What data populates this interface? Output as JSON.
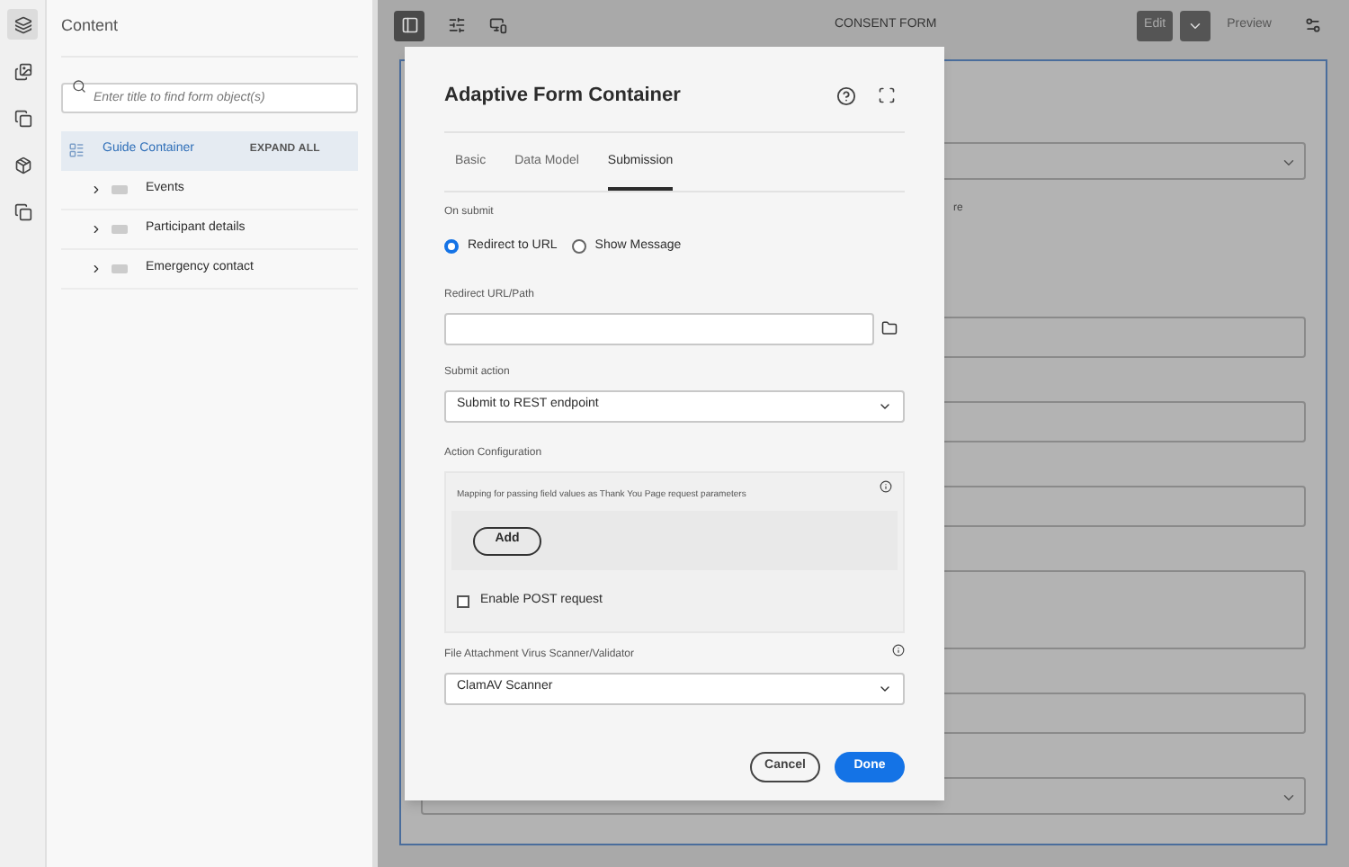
{
  "rail_items": [
    {
      "selected": true
    },
    {
      "selected": false
    },
    {
      "selected": false
    },
    {
      "selected": false
    },
    {
      "selected": false
    }
  ],
  "sidebar": {
    "title": "Content",
    "search": {
      "placeholder": "Enter title to find form object(s)"
    },
    "root": {
      "label": "Guide Container",
      "selected": true
    },
    "expand_all": "EXPAND ALL",
    "items": [
      {
        "label": "Events",
        "expanded": false
      },
      {
        "label": "Participant details",
        "expanded": false
      },
      {
        "label": "Emergency contact",
        "expanded": false
      }
    ]
  },
  "toolbar": {
    "title": "CONSENT FORM",
    "edit": "Edit",
    "preview": "Preview"
  },
  "background_form": {
    "fragment_text": "re"
  },
  "dialog": {
    "title": "Adaptive Form Container",
    "tabs": [
      {
        "label": "Basic",
        "selected": false
      },
      {
        "label": "Data Model",
        "selected": false
      },
      {
        "label": "Submission",
        "selected": true
      }
    ],
    "on_submit": {
      "label": "On submit",
      "options": [
        {
          "label": "Redirect to URL",
          "selected": true
        },
        {
          "label": "Show Message",
          "selected": false
        }
      ]
    },
    "redirect": {
      "label": "Redirect URL/Path"
    },
    "submit_action": {
      "label": "Submit action",
      "value": "Submit to REST endpoint"
    },
    "action_configuration": {
      "label": "Action Configuration",
      "description": "Mapping for passing field values as Thank You Page request parameters",
      "add_button": "Add",
      "enable_post": {
        "label": "Enable POST request",
        "checked": false
      }
    },
    "virus_scanner": {
      "label": "File Attachment Virus Scanner/Validator",
      "value": "ClamAV Scanner"
    },
    "cancel": "Cancel",
    "done": "Done"
  }
}
